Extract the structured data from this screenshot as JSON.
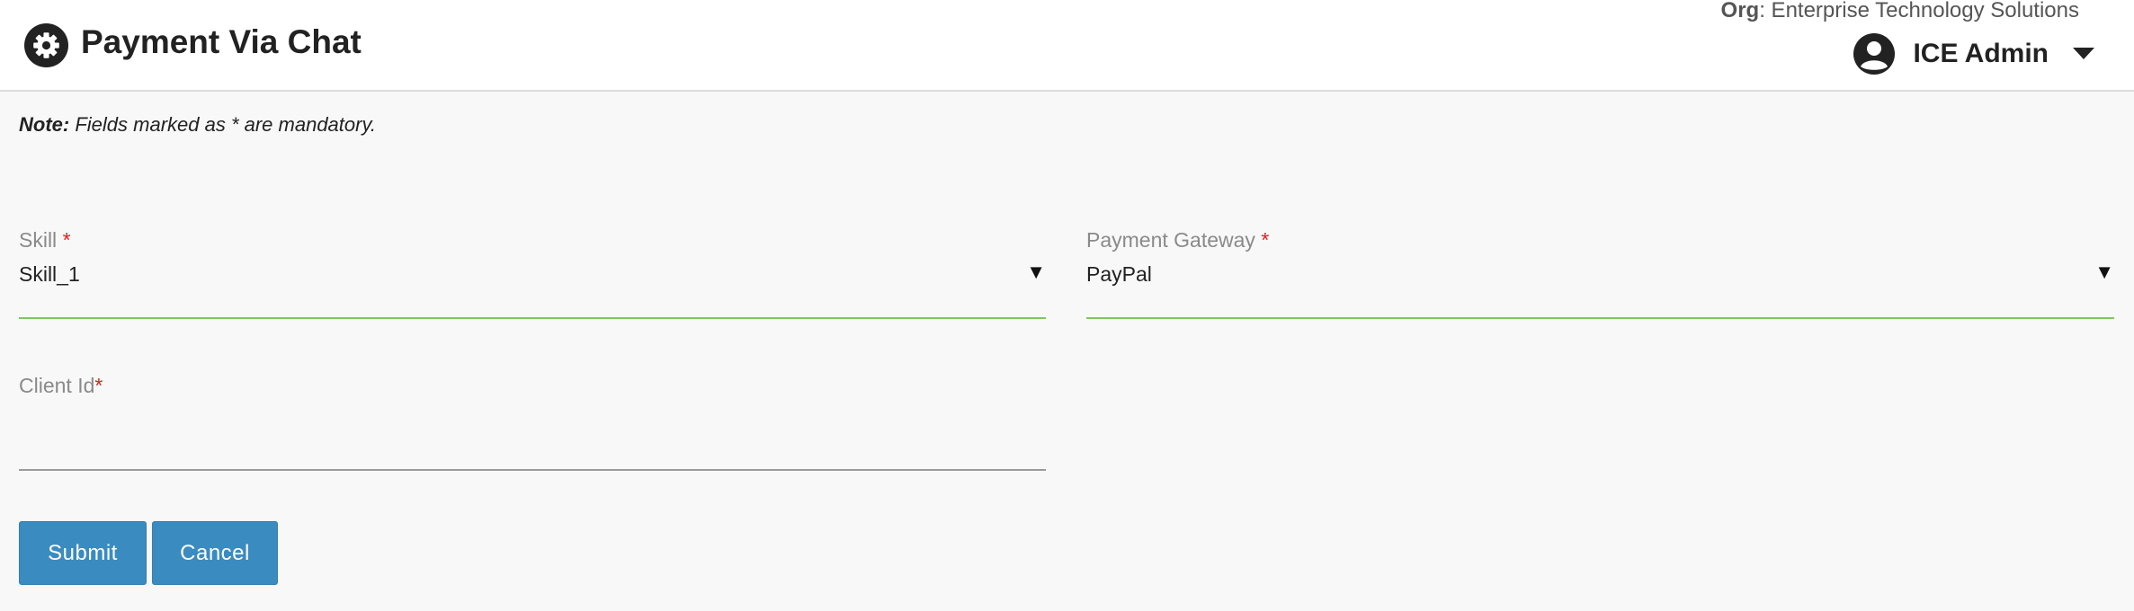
{
  "header": {
    "title": "Payment Via Chat",
    "title_icon": "gear-icon",
    "org_label": "Org",
    "org_value": ": Enterprise Technology Solutions",
    "user_name": "ICE Admin",
    "user_icon": "account-circle-icon",
    "user_menu_icon": "caret-down-icon"
  },
  "note": {
    "prefix": "Note:",
    "text": " Fields marked as * are mandatory."
  },
  "form": {
    "skill": {
      "label": "Skill ",
      "required_mark": "*",
      "value": "Skill_1",
      "arrow": "▼"
    },
    "payment_gateway": {
      "label": "Payment Gateway ",
      "required_mark": "*",
      "value": "PayPal",
      "arrow": "▼"
    },
    "client_id": {
      "label": "Client Id",
      "required_mark": "*",
      "value": ""
    }
  },
  "buttons": {
    "submit": "Submit",
    "cancel": "Cancel"
  },
  "colors": {
    "primary_button": "#3a8bbf",
    "valid_underline": "#7dc95e",
    "required": "#d9231f",
    "background": "#f8f8f8"
  }
}
